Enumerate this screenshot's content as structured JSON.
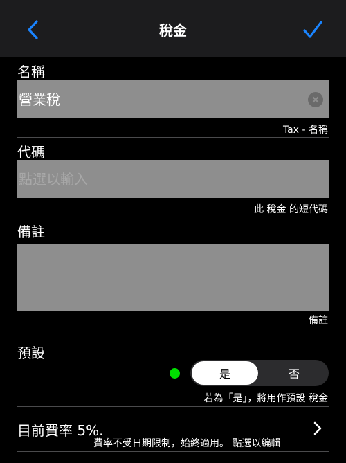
{
  "nav": {
    "title": "稅金",
    "back_icon": "chevron-left-icon",
    "done_icon": "checkmark-icon",
    "accent": "#1a84ff"
  },
  "name_section": {
    "label": "名稱",
    "value": "營業稅",
    "hint": "Tax - 名稱"
  },
  "code_section": {
    "label": "代碼",
    "value": "",
    "placeholder": "點選以輸入",
    "hint": "此 稅金 的短代碼"
  },
  "notes_section": {
    "label": "備註",
    "value": "",
    "hint": "備註"
  },
  "default_section": {
    "label": "預設",
    "options": [
      "是",
      "否"
    ],
    "selected": "是",
    "status_color": "#00e000",
    "hint": "若為「是」，將用作預設 稅金"
  },
  "rate_section": {
    "title": "目前費率 5%.",
    "subtitle": "費率不受日期限制，始終適用。 點選以編輯"
  }
}
